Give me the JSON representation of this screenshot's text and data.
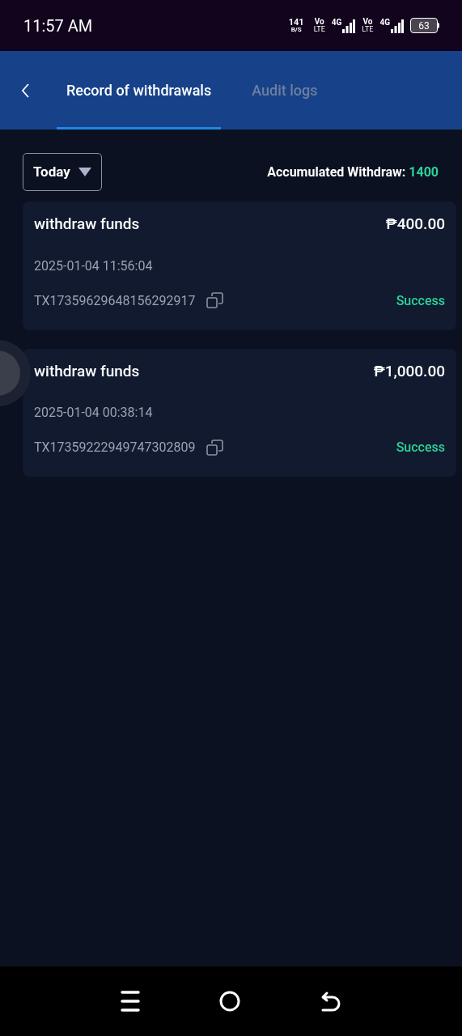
{
  "status_bar": {
    "time": "11:57 AM",
    "speed_value": "141",
    "speed_unit": "B/S",
    "sim1_top": "Vo",
    "sim1_bottom": "LTE",
    "sim1_network": "4G",
    "sim2_top": "Vo",
    "sim2_bottom": "LTE",
    "sim2_network": "4G",
    "battery": "63"
  },
  "tabs": [
    {
      "label": "Record of withdrawals",
      "selected": true
    },
    {
      "label": "Audit logs",
      "selected": false
    }
  ],
  "filter": {
    "label": "Today"
  },
  "summary": {
    "label": "Accumulated Withdraw:",
    "value": "1400"
  },
  "records": [
    {
      "title": "withdraw funds",
      "amount": "₱400.00",
      "time": "2025-01-04 11:56:04",
      "tx_id": "TX17359629648156292917",
      "status": "Success"
    },
    {
      "title": "withdraw funds",
      "amount": "₱1,000.00",
      "time": "2025-01-04 00:38:14",
      "tx_id": "TX17359222949747302809",
      "status": "Success"
    }
  ]
}
